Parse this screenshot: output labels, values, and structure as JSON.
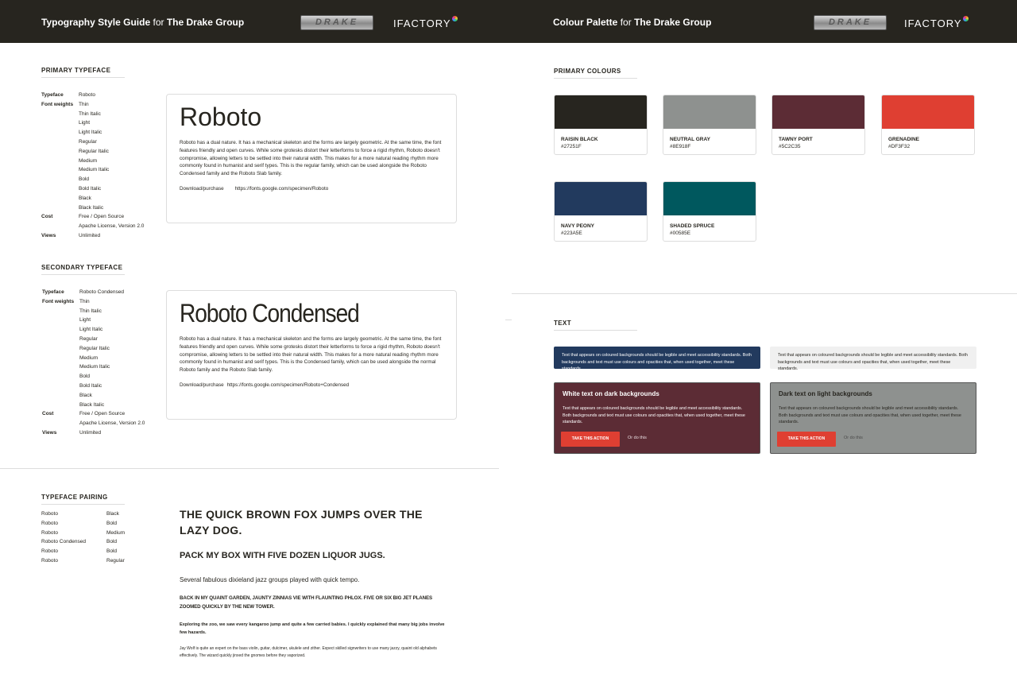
{
  "typography": {
    "header": {
      "title_main": "Typography Style Guide",
      "title_for": "for",
      "title_client": "The Drake Group"
    },
    "logos": {
      "drake": "DRAKE",
      "ifactory": "IFACTORY"
    },
    "primary": {
      "heading": "PRIMARY TYPEFACE",
      "typeface_label": "Typeface",
      "typeface": "Roboto",
      "weights_label": "Font weights",
      "weights": [
        "Thin",
        "Thin Italic",
        "Light",
        "Light Italic",
        "Regular",
        "Regular Italic",
        "Medium",
        "Medium Italic",
        "Bold",
        "Bold Italic",
        "Black",
        "Black Italic"
      ],
      "cost_label": "Cost",
      "cost": [
        "Free / Open Source",
        "Apache License, Version 2.0"
      ],
      "views_label": "Views",
      "views": "Unlimited",
      "sample_name": "Roboto",
      "description": "Roboto has a dual nature. It has a mechanical skeleton and the forms are largely geometric. At the same time, the font features friendly and open curves. While some grotesks distort their letterforms to force a rigid rhythm, Roboto doesn't compromise, allowing letters to be settled into their natural width. This makes for a more natural reading rhythm more commonly found in humanist and serif types. This is the regular family, which can be used alongside the Roboto Condensed family and the Roboto Slab family.",
      "download_label": "Download/purchase",
      "download_url": "https://fonts.google.com/specimen/Roboto"
    },
    "secondary": {
      "heading": "SECONDARY TYPEFACE",
      "typeface_label": "Typeface",
      "typeface": "Roboto Condensed",
      "weights_label": "Font weights",
      "weights": [
        "Thin",
        "Thin Italic",
        "Light",
        "Light Italic",
        "Regular",
        "Regular Italic",
        "Medium",
        "Medium Italic",
        "Bold",
        "Bold Italic",
        "Black",
        "Black Italic"
      ],
      "cost_label": "Cost",
      "cost": [
        "Free / Open Source",
        "Apache License, Version 2.0"
      ],
      "views_label": "Views",
      "views": "Unlimited",
      "sample_name": "Roboto Condensed",
      "description": "Roboto has a dual nature. It has a mechanical skeleton and the forms are largely geometric. At the same time, the font features friendly and open curves. While some grotesks distort their letterforms to force a rigid rhythm, Roboto doesn't compromise, allowing letters to be settled into their natural width. This makes for a more natural reading rhythm more commonly found in humanist and serif types. This is the Condensed family, which can be used alongside the normal Roboto family and the Roboto Slab family.",
      "download_label": "Download/purchase",
      "download_url": "https://fonts.google.com/specimen/Roboto+Condensed"
    },
    "pairing": {
      "heading": "TYPEFACE PAIRING",
      "rows": [
        {
          "font": "Roboto",
          "weight": "Black"
        },
        {
          "font": "Roboto",
          "weight": "Bold"
        },
        {
          "font": "Roboto",
          "weight": "Medium"
        },
        {
          "font": "Roboto Condensed",
          "weight": "Bold"
        },
        {
          "font": "Roboto",
          "weight": "Bold"
        },
        {
          "font": "Roboto",
          "weight": "Regular"
        }
      ],
      "samples": [
        "THE QUICK BROWN FOX JUMPS OVER THE LAZY DOG.",
        "PACK MY BOX WITH FIVE DOZEN LIQUOR JUGS.",
        "Several fabulous dixieland jazz groups played with quick tempo.",
        "BACK IN MY QUAINT GARDEN, JAUNTY ZINNIAS VIE WITH FLAUNTING PHLOX. FIVE OR SIX BIG JET PLANES ZOOMED QUICKLY BY THE NEW TOWER.",
        "Exploring the zoo, we saw every kangaroo jump and quite a few carried babies.  I quickly explained that many big jobs involve few hazards.",
        "Jay Wolf is quite an expert on the bass violin, guitar, dulcimer, ukulele and zither. Expect skilled signwriters to use many jazzy, quaint old alphabets effectively. The wizard quickly jinxed the gnomes before they vaporized."
      ]
    }
  },
  "palette": {
    "header": {
      "title_main": "Colour Palette",
      "title_for": "for",
      "title_client": "The Drake Group"
    },
    "logos": {
      "drake": "DRAKE",
      "ifactory": "IFACTORY"
    },
    "primary_heading": "PRIMARY COLOURS",
    "colours": [
      {
        "name": "RAISIN BLACK",
        "hex": "#27251F"
      },
      {
        "name": "NEUTRAL GRAY",
        "hex": "#8E918F"
      },
      {
        "name": "TAWNY PORT",
        "hex": "#5C2C35"
      },
      {
        "name": "GRENADINE",
        "hex": "#DF3F32"
      },
      {
        "name": "NAVY PEONY",
        "hex": "#223A5E"
      },
      {
        "name": "SHADED SPRUCE",
        "hex": "#00585E"
      }
    ],
    "text_heading": "TEXT",
    "legible_text": "Text that appears on coloured backgrounds should be legible and meet accessibility standards. Both backgrounds and text must use colours and opacities that, when used together, meet these standards.",
    "dark_box": {
      "heading": "White text on dark backgrounds",
      "button": "TAKE THIS ACTION",
      "alt": "Or do this"
    },
    "light_box": {
      "heading": "Dark text on light backgrounds",
      "button": "TAKE THIS ACTION",
      "alt": "Or do this"
    }
  }
}
